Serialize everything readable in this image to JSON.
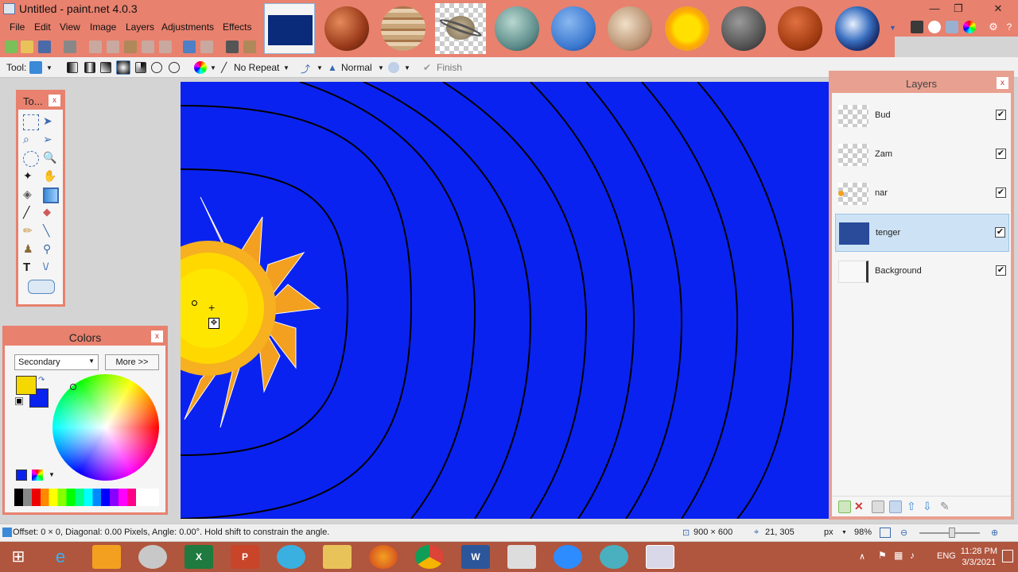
{
  "window": {
    "title": "Untitled - paint.net 4.0.3",
    "minimize": "—",
    "maximize": "❐",
    "close": "✕"
  },
  "menu": [
    "File",
    "Edit",
    "View",
    "Image",
    "Layers",
    "Adjustments",
    "Effects"
  ],
  "toolbar2": {
    "tool_label": "Tool:",
    "repeat": "No Repeat",
    "blend": "Normal",
    "finish": "Finish"
  },
  "tools_panel": {
    "title": "To...",
    "close": "x"
  },
  "colors_panel": {
    "title": "Colors",
    "close": "x",
    "select_value": "Secondary",
    "more_button": "More >>",
    "primary_color": "#f5d800",
    "secondary_color": "#0a22f0"
  },
  "layers_panel": {
    "title": "Layers",
    "close": "x",
    "layers": [
      {
        "name": "Bud",
        "visible": true
      },
      {
        "name": "Zam",
        "visible": true
      },
      {
        "name": "nar",
        "visible": true
      },
      {
        "name": "tenger",
        "visible": true,
        "selected": true
      },
      {
        "name": "Background",
        "visible": true
      }
    ]
  },
  "thumbnails": [
    "current-image",
    "mars",
    "jupiter",
    "saturn",
    "uranus",
    "neptune",
    "pluto",
    "sun",
    "mercury",
    "venus",
    "earth"
  ],
  "status": {
    "message": "Offset: 0 × 0, Diagonal: 0.00 Pixels, Angle: 0.00°. Hold shift to constrain the angle.",
    "image_size": "900 × 600",
    "cursor": "21, 305",
    "units": "px",
    "zoom": "98%"
  },
  "taskbar": {
    "language": "ENG",
    "time": "11:28 PM",
    "date": "3/3/2021"
  },
  "accent": "#e8816e"
}
